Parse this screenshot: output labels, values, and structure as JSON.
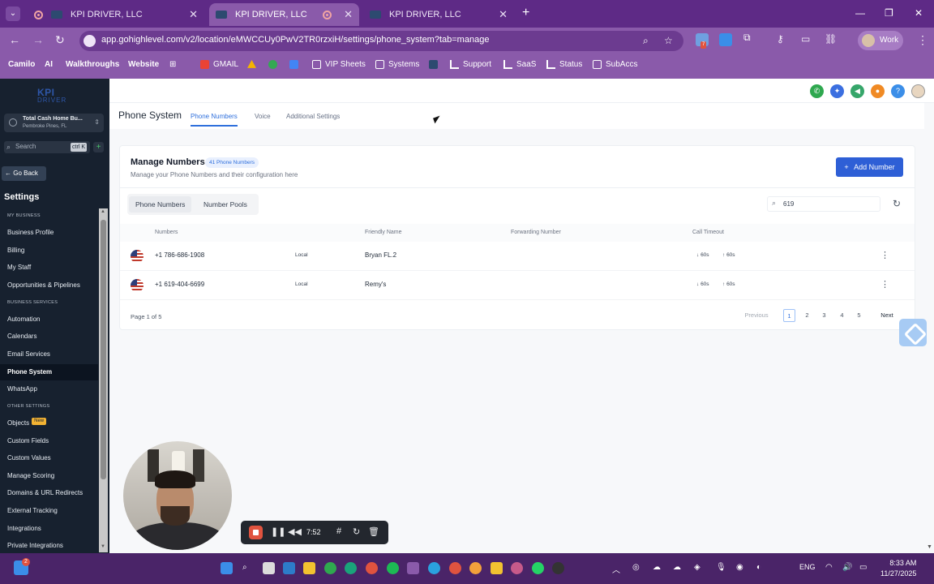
{
  "browser": {
    "tabs": [
      {
        "title": "KPI DRIVER, LLC"
      },
      {
        "title": "KPI DRIVER, LLC"
      },
      {
        "title": "KPI DRIVER, LLC"
      }
    ],
    "url": "app.gohighlevel.com/v2/location/eMWCCUy0PwV2TR0rzxiH/settings/phone_system?tab=manage",
    "profile_label": "Work",
    "extension_badge": "7",
    "bookmarks": [
      "Camilo",
      "AI",
      "Walkthroughs",
      "Website",
      "GMAIL",
      "VIP Sheets",
      "Systems",
      "Support",
      "SaaS",
      "Status",
      "SubAccs"
    ]
  },
  "sidebar": {
    "logo_line1": "KPI",
    "logo_line2": "DRIVER",
    "account_name": "Total Cash Home Bu...",
    "account_location": "Pembroke Pines, FL",
    "search_placeholder": "Search",
    "search_shortcut": "ctrl K",
    "go_back": "Go Back",
    "title": "Settings",
    "sections": {
      "my_business": "MY BUSINESS",
      "business_services": "BUSINESS SERVICES",
      "other_settings": "OTHER SETTINGS"
    },
    "items": {
      "business_profile": "Business Profile",
      "billing": "Billing",
      "my_staff": "My Staff",
      "opportunities": "Opportunities & Pipelines",
      "automation": "Automation",
      "calendars": "Calendars",
      "email_services": "Email Services",
      "phone_system": "Phone System",
      "whatsapp": "WhatsApp",
      "objects": "Objects",
      "objects_badge": "New",
      "custom_fields": "Custom Fields",
      "custom_values": "Custom Values",
      "manage_scoring": "Manage Scoring",
      "domains": "Domains & URL Redirects",
      "external_tracking": "External Tracking",
      "integrations": "Integrations",
      "private_integrations": "Private Integrations"
    }
  },
  "page": {
    "title": "Phone System",
    "tabs": [
      "Phone Numbers",
      "Voice",
      "Additional Settings"
    ],
    "active_tab": "Phone Numbers"
  },
  "manage": {
    "title": "Manage Numbers",
    "count_badge": "41 Phone Numbers",
    "subtitle": "Manage your Phone Numbers and their configuration here",
    "add_button": "Add Number",
    "segments": [
      "Phone Numbers",
      "Number Pools"
    ],
    "search_value": "619",
    "columns": [
      "Numbers",
      "Friendly Name",
      "Forwarding Number",
      "Call Timeout"
    ],
    "rows": [
      {
        "number": "+1 786-686-1908",
        "type": "Local",
        "friendly_name": "Bryan FL.2",
        "forwarding": "",
        "timeout_in": "60s",
        "timeout_out": "60s"
      },
      {
        "number": "+1 619-404-6699",
        "type": "Local",
        "friendly_name": "Remy's",
        "forwarding": "",
        "timeout_in": "60s",
        "timeout_out": "60s"
      }
    ],
    "page_info": "Page 1 of 5",
    "pagination": {
      "previous": "Previous",
      "pages": [
        "1",
        "2",
        "3",
        "4",
        "5"
      ],
      "next": "Next"
    }
  },
  "recorder": {
    "time": "7:52"
  },
  "taskbar": {
    "language": "ENG",
    "time": "8:33 AM",
    "date": "11/27/2025",
    "notification_count": "2"
  }
}
